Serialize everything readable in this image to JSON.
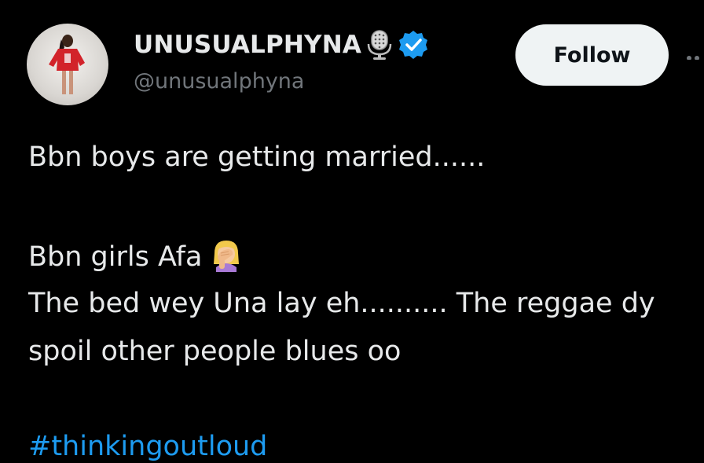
{
  "account": {
    "display_name": "UNUSUALPHYNA",
    "handle": "@unusualphyna",
    "badges": [
      "microphone-icon",
      "verified-icon"
    ],
    "verified_color": "#1d9bf0"
  },
  "actions": {
    "follow_label": "Follow",
    "more_icon": "more-options-icon"
  },
  "tweet": {
    "line1": "Bbn boys are getting married......",
    "line2": "Bbn girls Afa",
    "line2_emoji": "woman-facepalming-emoji",
    "line3": "The bed wey Una lay eh.......... The reggae dy",
    "line4": "spoil other people blues oo",
    "hashtag": "#thinkingoutloud"
  },
  "colors": {
    "background": "#000000",
    "text": "#e7e9ea",
    "muted": "#71767b",
    "link": "#1d9bf0",
    "button_bg": "#eff3f4"
  }
}
